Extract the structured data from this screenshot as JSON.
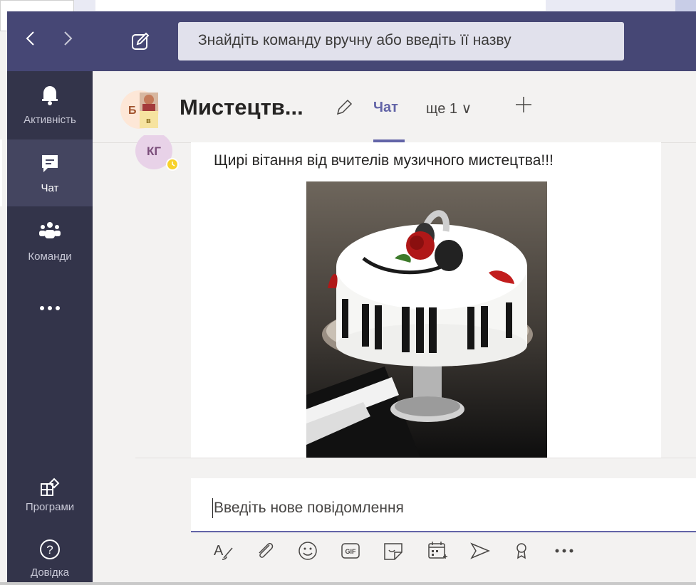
{
  "search": {
    "placeholder": "Знайдіть команду вручну або введіть її назву"
  },
  "rail": {
    "items": [
      {
        "label": "Активність",
        "icon": "bell-icon"
      },
      {
        "label": "Чат",
        "icon": "chat-icon"
      },
      {
        "label": "Команди",
        "icon": "teams-icon"
      },
      {
        "label": "",
        "icon": "more-apps-icon"
      },
      {
        "label": "Програми",
        "icon": "apps-icon"
      },
      {
        "label": "Довідка",
        "icon": "help-icon"
      }
    ]
  },
  "header": {
    "avatar_initial_1": "Б",
    "avatar_initial_2": "в",
    "title": "Мистецтв...",
    "tab_chat": "Чат",
    "tab_more": "ще 1 ∨"
  },
  "message": {
    "sender_initials": "КГ",
    "text": "Щирі вітання від вчителів музичного мистецтва!!!"
  },
  "compose": {
    "placeholder": "Введіть нове повідомлення"
  },
  "toolbar": {
    "tools": [
      "format-icon",
      "attach-icon",
      "emoji-icon",
      "gif-icon",
      "sticker-icon",
      "schedule-meeting-icon",
      "stream-icon",
      "praise-icon",
      "more-options-icon"
    ]
  },
  "colors": {
    "titlebar": "#464775",
    "rail": "#33344a",
    "accent": "#6264a7",
    "presence_away": "#f8d22a"
  }
}
